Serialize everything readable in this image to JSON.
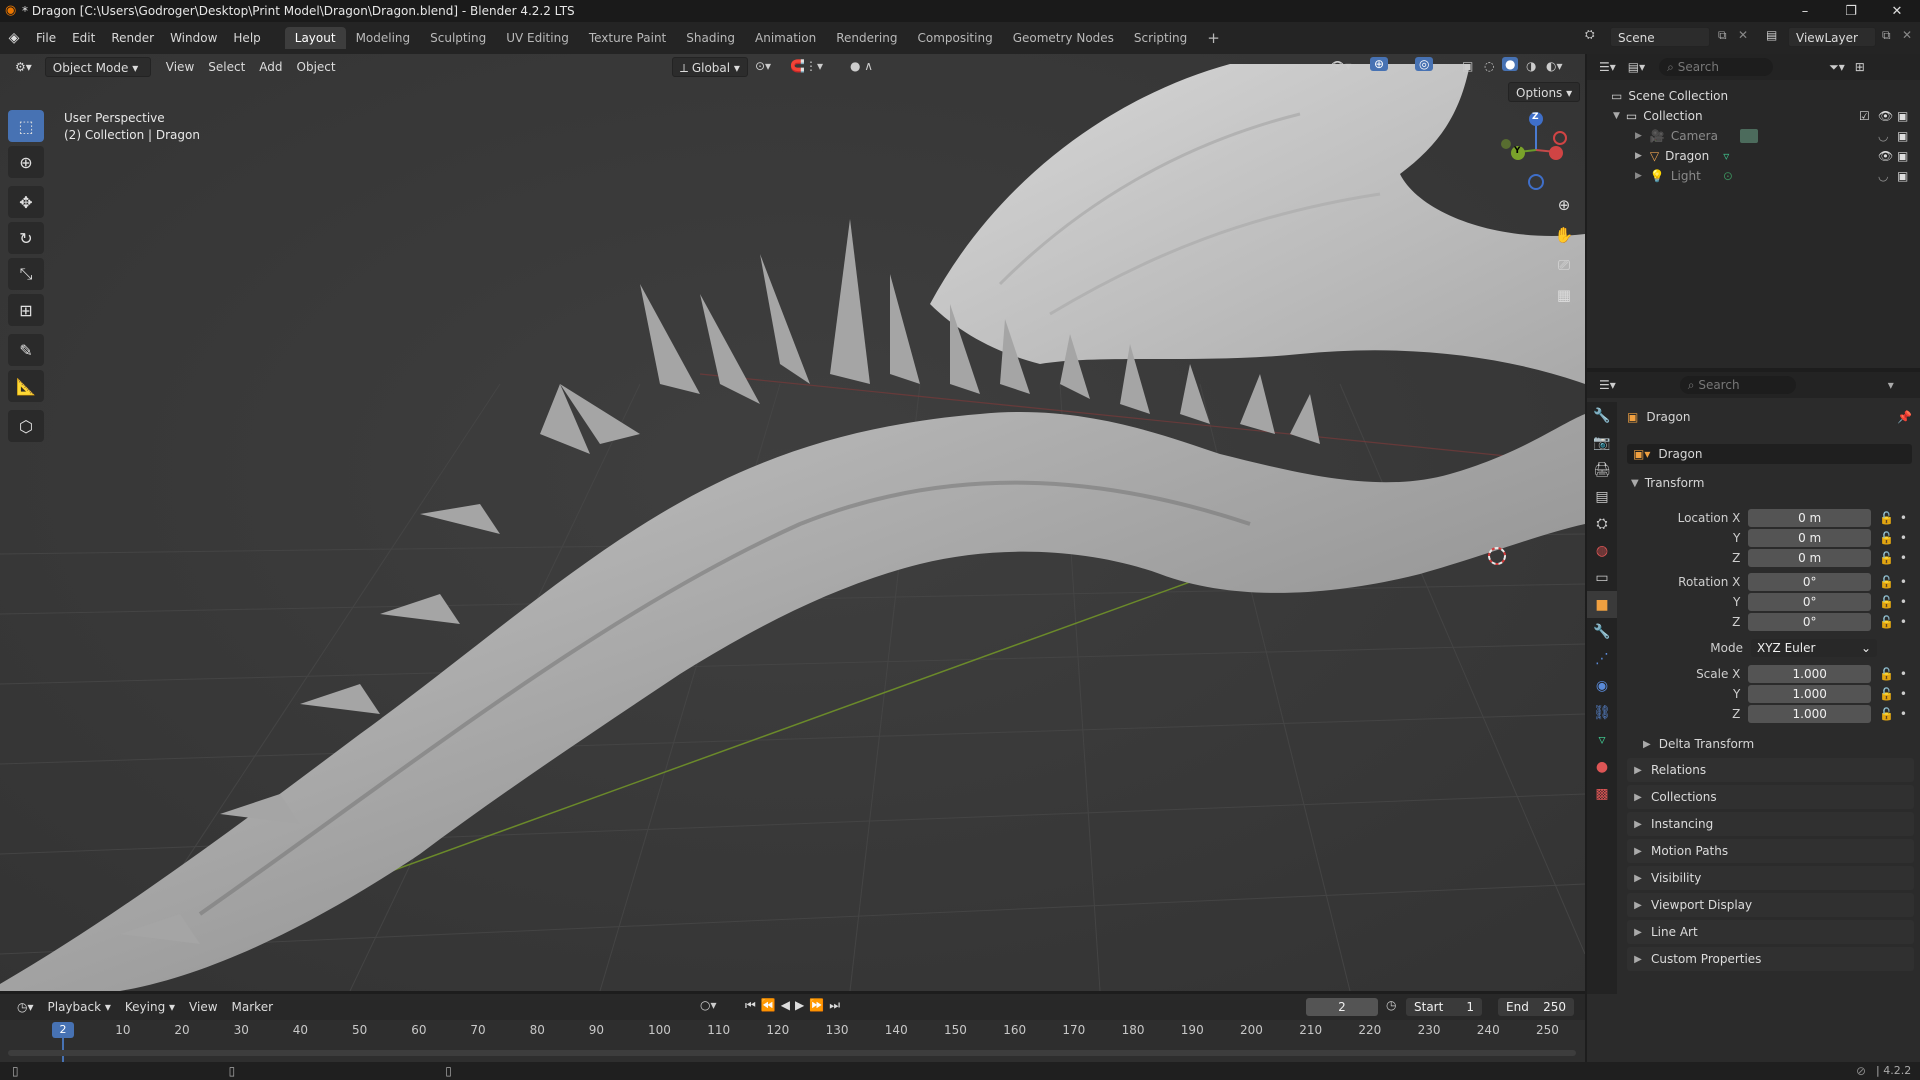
{
  "titlebar": {
    "title": "* Dragon [C:\\Users\\Godroger\\Desktop\\Print Model\\Dragon\\Dragon.blend] - Blender 4.2.2 LTS",
    "minimize": "–",
    "restore": "❐",
    "close": "✕"
  },
  "menubar": {
    "menus": [
      "File",
      "Edit",
      "Render",
      "Window",
      "Help"
    ],
    "workspaces": [
      "Layout",
      "Modeling",
      "Sculpting",
      "UV Editing",
      "Texture Paint",
      "Shading",
      "Animation",
      "Rendering",
      "Compositing",
      "Geometry Nodes",
      "Scripting"
    ],
    "active_workspace": "Layout",
    "add_workspace": "+",
    "scene_label": "Scene",
    "viewlayer_label": "ViewLayer"
  },
  "viewport_header": {
    "mode": "Object Mode",
    "menus": [
      "View",
      "Select",
      "Add",
      "Object"
    ],
    "orientation": "Global",
    "options": "Options"
  },
  "viewport": {
    "overlay_line1": "User Perspective",
    "overlay_line2": "(2) Collection | Dragon",
    "gizmo": {
      "z": "Z",
      "y": "Y",
      "x": "X"
    }
  },
  "toolbar": {
    "tools": [
      "select-box-icon",
      "cursor-icon",
      "move-icon",
      "rotate-icon",
      "scale-icon",
      "transform-icon",
      "annotate-icon",
      "measure-icon",
      "add-cube-icon"
    ]
  },
  "outliner": {
    "search_placeholder": "Search",
    "scene_collection": "Scene Collection",
    "collection": "Collection",
    "items": [
      {
        "name": "Camera",
        "type": "camera-icon",
        "dim": true
      },
      {
        "name": "Dragon",
        "type": "mesh-icon",
        "dim": false
      },
      {
        "name": "Light",
        "type": "light-icon",
        "dim": true
      }
    ]
  },
  "properties": {
    "search_placeholder": "Search",
    "object_name": "Dragon",
    "datablock_name": "Dragon",
    "transform_title": "Transform",
    "location": {
      "label": "Location X",
      "x": "0 m",
      "y": "0 m",
      "z": "0 m"
    },
    "rotation": {
      "label": "Rotation X",
      "x": "0°",
      "y": "0°",
      "z": "0°"
    },
    "mode_label": "Mode",
    "mode_value": "XYZ Euler",
    "scale": {
      "label": "Scale X",
      "x": "1.000",
      "y": "1.000",
      "z": "1.000"
    },
    "axis_y": "Y",
    "axis_z": "Z",
    "delta_transform": "Delta Transform",
    "panels": [
      "Relations",
      "Collections",
      "Instancing",
      "Motion Paths",
      "Visibility",
      "Viewport Display",
      "Line Art",
      "Custom Properties"
    ]
  },
  "timeline": {
    "menus": [
      "Playback",
      "Keying",
      "View",
      "Marker"
    ],
    "current_frame": "2",
    "start_label": "Start",
    "start_value": "1",
    "end_label": "End",
    "end_value": "250",
    "ruler_ticks": [
      "10",
      "20",
      "30",
      "40",
      "50",
      "60",
      "70",
      "80",
      "90",
      "100",
      "110",
      "120",
      "130",
      "140",
      "150",
      "160",
      "170",
      "180",
      "190",
      "200",
      "210",
      "220",
      "230",
      "240",
      "250"
    ],
    "playhead_label": "2"
  },
  "statusbar": {
    "version": "4.2.2"
  }
}
